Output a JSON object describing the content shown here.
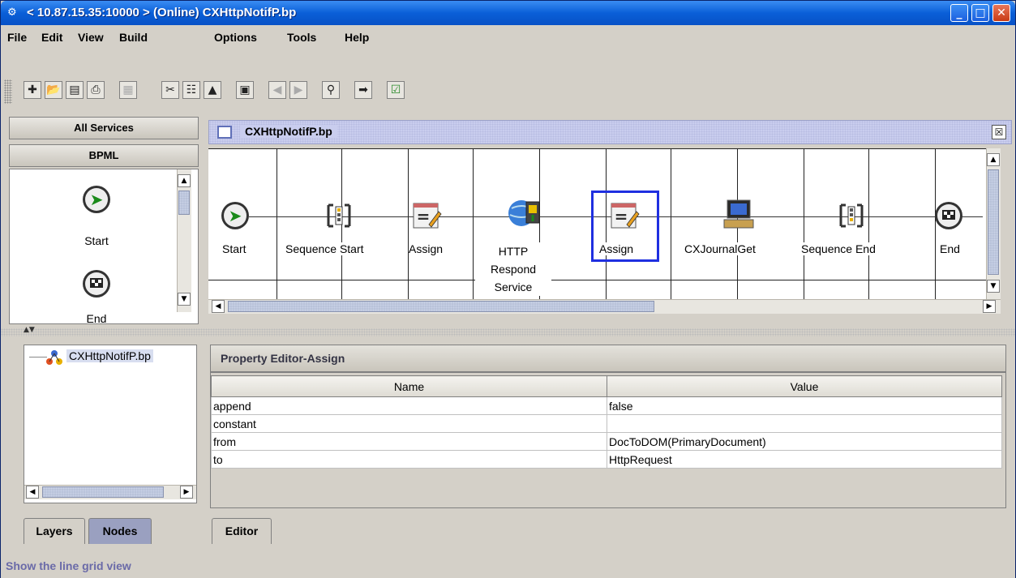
{
  "window": {
    "title": "< 10.87.15.35:10000 > (Online) CXHttpNotifP.bp",
    "controls": [
      "minimize",
      "maximize",
      "close"
    ]
  },
  "menu": [
    "File",
    "Edit",
    "View",
    "Build",
    "Options",
    "Tools",
    "Help"
  ],
  "toolbar": {
    "buttons": [
      "new-icon",
      "open-icon",
      "save-icon",
      "print-icon",
      "grid-icon",
      "cut-icon",
      "copy-icon",
      "paste-icon",
      "window-icon",
      "back-icon",
      "forward-icon",
      "search-icon",
      "export-icon",
      "check-icon"
    ]
  },
  "left_panel": {
    "all_services": "All Services",
    "bpml": "BPML",
    "palette": [
      {
        "label": "Start",
        "icon": "start-icon"
      },
      {
        "label": "End",
        "icon": "end-icon"
      }
    ]
  },
  "document": {
    "title": "CXHttpNotifP.bp"
  },
  "process": {
    "nodes": [
      {
        "label": "Start",
        "icon": "start-icon"
      },
      {
        "label": "Sequence Start",
        "icon": "sequence-start-icon"
      },
      {
        "label": "Assign",
        "icon": "assign-icon"
      },
      {
        "label": "HTTP Respond Service",
        "icon": "http-respond-icon"
      },
      {
        "label": "Assign",
        "icon": "assign-icon",
        "selected": true
      },
      {
        "label": "CXJournalGet",
        "icon": "computer-icon"
      },
      {
        "label": "Sequence End",
        "icon": "sequence-end-icon"
      },
      {
        "label": "End",
        "icon": "end-icon"
      }
    ]
  },
  "tree": {
    "root": "CXHttpNotifP.bp"
  },
  "tabs_left": [
    "Layers",
    "Nodes"
  ],
  "property_editor": {
    "title": "Property Editor-Assign",
    "columns": [
      "Name",
      "Value"
    ],
    "rows": [
      {
        "name": "append",
        "value": "false"
      },
      {
        "name": "constant",
        "value": ""
      },
      {
        "name": "from",
        "value": "DocToDOM(PrimaryDocument)"
      },
      {
        "name": "to",
        "value": "HttpRequest"
      }
    ]
  },
  "tabs_right": [
    "Editor"
  ],
  "status": "Show the line grid view",
  "colors": {
    "selection": "#1f2fe0",
    "titlebar": "#0a5fd8",
    "status_text": "#6a6aa8"
  }
}
